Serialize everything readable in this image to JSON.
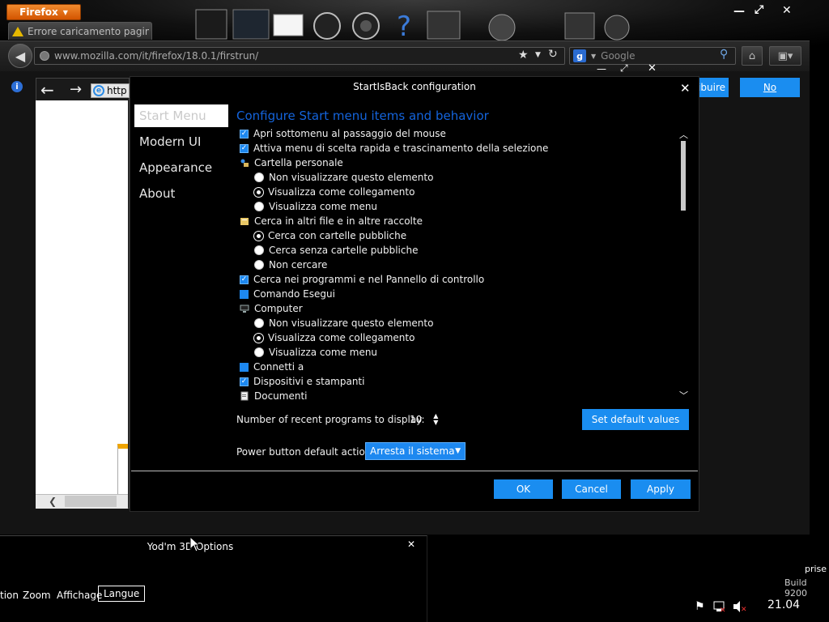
{
  "firefox": {
    "menu_label": "Firefox",
    "tab_label": "Errore caricamento pagina",
    "url": "www.mozilla.com/it/firefox/18.0.1/firstrun/",
    "search_placeholder": "Google",
    "info_glyph": "i",
    "contribute_label": "ibuire",
    "no_label": "No"
  },
  "ie": {
    "address_text": "http"
  },
  "sib": {
    "title": "StartIsBack configuration",
    "nav": [
      "Start Menu",
      "Modern UI",
      "Appearance",
      "About"
    ],
    "heading": "Configure Start menu items and behavior",
    "items": [
      {
        "kind": "check",
        "checked": true,
        "label": "Apri sottomenu al passaggio del mouse"
      },
      {
        "kind": "check",
        "checked": true,
        "label": "Attiva menu di scelta rapida e trascinamento della selezione"
      },
      {
        "kind": "icon",
        "icon": "user-folder-icon",
        "label": "Cartella personale"
      },
      {
        "kind": "radio",
        "selected": false,
        "label": "Non visualizzare questo elemento"
      },
      {
        "kind": "radio",
        "selected": true,
        "label": "Visualizza come collegamento"
      },
      {
        "kind": "radio",
        "selected": false,
        "label": "Visualizza come menu"
      },
      {
        "kind": "icon",
        "icon": "search-folder-icon",
        "label": "Cerca in altri file e in altre raccolte"
      },
      {
        "kind": "radio",
        "selected": true,
        "label": "Cerca con cartelle pubbliche"
      },
      {
        "kind": "radio",
        "selected": false,
        "label": "Cerca senza cartelle pubbliche"
      },
      {
        "kind": "radio",
        "selected": false,
        "label": "Non cercare"
      },
      {
        "kind": "check",
        "checked": true,
        "label": "Cerca nei programmi e nel Pannello di controllo"
      },
      {
        "kind": "check",
        "checked": false,
        "label": "Comando Esegui"
      },
      {
        "kind": "icon",
        "icon": "computer-icon",
        "label": "Computer"
      },
      {
        "kind": "radio",
        "selected": false,
        "label": "Non visualizzare questo elemento"
      },
      {
        "kind": "radio",
        "selected": true,
        "label": "Visualizza come collegamento"
      },
      {
        "kind": "radio",
        "selected": false,
        "label": "Visualizza come menu"
      },
      {
        "kind": "check",
        "checked": false,
        "label": "Connetti a"
      },
      {
        "kind": "check",
        "checked": true,
        "label": "Dispositivi e stampanti"
      },
      {
        "kind": "icon",
        "icon": "documents-icon",
        "label": "Documenti"
      }
    ],
    "recent_label": "Number of recent programs to display:",
    "recent_value": "10",
    "default_button": "Set default values",
    "power_label": "Power button default action:",
    "power_value": "Arresta il sistema",
    "ok": "OK",
    "cancel": "Cancel",
    "apply": "Apply"
  },
  "yodm": {
    "title": "Yod'm 3D Options",
    "tabs": [
      "tion",
      "Zoom",
      "Affichage",
      "Langue"
    ],
    "close": "✕"
  },
  "tray": {
    "clock": "21.04",
    "text_a": "prise",
    "text_b": "Build 9200"
  },
  "colors": {
    "accent": "#1d88f0",
    "heading": "#1464dc",
    "firefox_orange": "#e8711c"
  }
}
